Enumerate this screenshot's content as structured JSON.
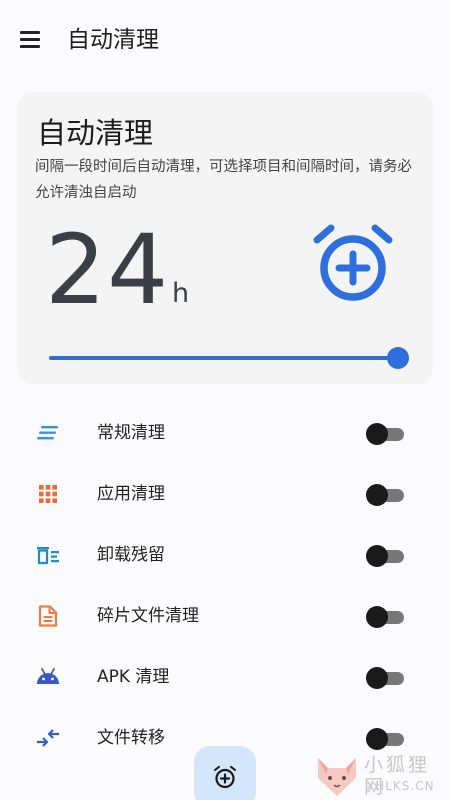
{
  "appbar": {
    "title": "自动清理",
    "menu_icon": "menu-icon"
  },
  "card": {
    "title": "自动清理",
    "description": "间隔一段时间后自动清理，可选择项目和间隔时间，请务必允许清浊自启动",
    "hours_value": "24",
    "hours_unit": "h",
    "alarm_icon": "alarm-add-icon",
    "accent_color": "#2f6fdd",
    "slider_level": 1.0
  },
  "items": [
    {
      "label": "常规清理",
      "icon": "lines-icon",
      "icon_color": "#3a8ee6",
      "enabled": false
    },
    {
      "label": "应用清理",
      "icon": "grid-icon",
      "icon_color": "#ee6a3c",
      "enabled": false
    },
    {
      "label": "卸载残留",
      "icon": "trash-list-icon",
      "icon_color": "#1f8bc8",
      "enabled": false
    },
    {
      "label": "碎片文件清理",
      "icon": "document-icon",
      "icon_color": "#ef7b4b",
      "enabled": false
    },
    {
      "label": "APK 清理",
      "icon": "android-icon",
      "icon_color": "#3a56c7",
      "enabled": false
    },
    {
      "label": "文件转移",
      "icon": "transfer-icon",
      "icon_color": "#2f5fc7",
      "enabled": false
    }
  ],
  "fab": {
    "icon": "alarm-add-icon",
    "color": "#d4e6fb"
  },
  "watermark": {
    "name": "小狐狸网",
    "domain": "XHLKS.CN"
  }
}
